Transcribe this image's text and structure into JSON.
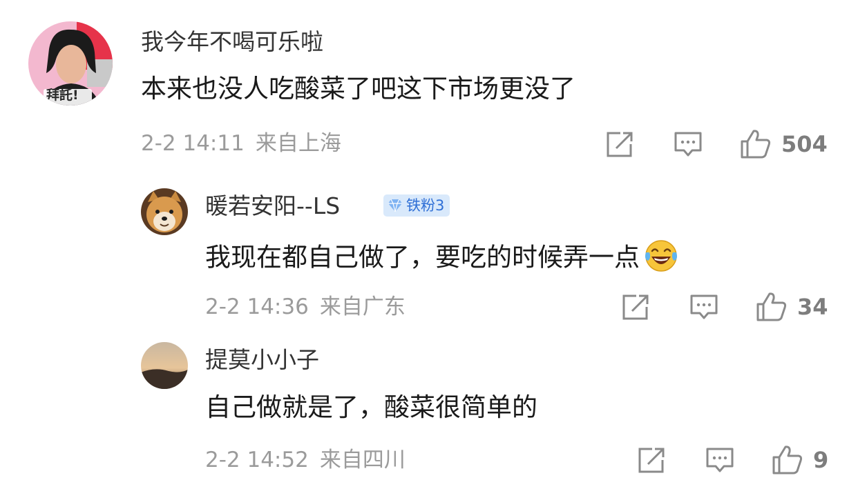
{
  "comments": [
    {
      "username": "我今年不喝可乐啦",
      "avatar_caption": "拜託!",
      "text": "本来也没人吃酸菜了吧这下市场更没了",
      "time": "2-2 14:11",
      "location": "来自上海",
      "likes": "504"
    },
    {
      "username": "暖若安阳--LS",
      "badge": "铁粉3",
      "text": "我现在都自己做了，要吃的时候弄一点",
      "time": "2-2 14:36",
      "location": "来自广东",
      "likes": "34"
    },
    {
      "username": "提莫小小子",
      "text": "自己做就是了，酸菜很简单的",
      "time": "2-2 14:52",
      "location": "来自四川",
      "likes": "9"
    }
  ],
  "colors": {
    "text": "#1a1a1a",
    "meta": "#9b9b9b",
    "icon": "#8a8a8a",
    "badge_bg": "#d9e9fb",
    "badge_text": "#2f6fd6"
  },
  "icons": {
    "share": "share-icon",
    "comment": "comment-icon",
    "like": "thumbs-up-icon",
    "badge": "diamond-icon",
    "emoji": "laughing-tears-emoji"
  }
}
